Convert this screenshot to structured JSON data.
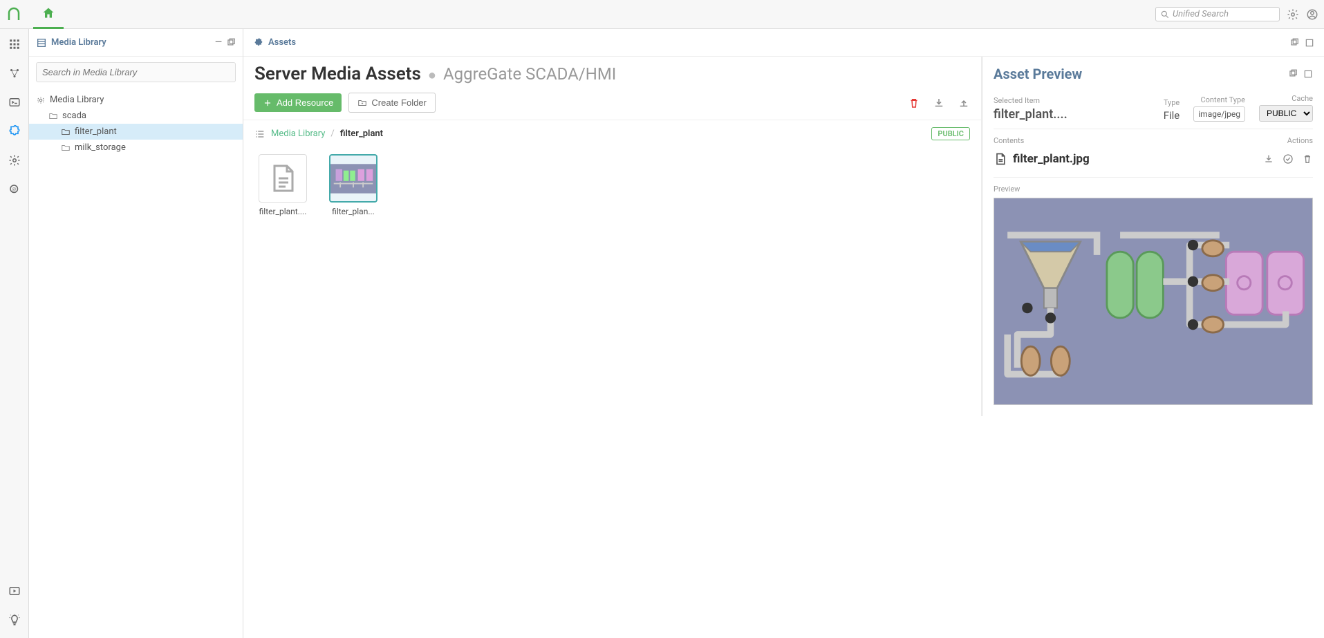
{
  "header": {
    "search_placeholder": "Unified Search"
  },
  "sidebar": {
    "title": "Media Library",
    "search_placeholder": "Search in Media Library",
    "tree": {
      "root": "Media Library",
      "items": [
        {
          "label": "scada"
        },
        {
          "label": "filter_plant"
        },
        {
          "label": "milk_storage"
        }
      ]
    }
  },
  "content": {
    "section": "Assets",
    "title": "Server Media Assets",
    "subtitle": "AggreGate SCADA/HMI",
    "add_resource": "Add Resource",
    "create_folder": "Create Folder",
    "breadcrumb_root": "Media Library",
    "breadcrumb_current": "filter_plant",
    "badge": "PUBLIC",
    "items": [
      {
        "label": "filter_plant...."
      },
      {
        "label": "filter_plan..."
      }
    ]
  },
  "preview": {
    "title": "Asset Preview",
    "selected_item_label": "Selected Item",
    "selected_item_value": "filter_plant....",
    "type_label": "Type",
    "type_value": "File",
    "content_type_label": "Content Type",
    "content_type_value": "image/jpeg",
    "cache_label": "Cache",
    "cache_value": "PUBLIC",
    "contents_label": "Contents",
    "actions_label": "Actions",
    "filename": "filter_plant.jpg",
    "preview_label": "Preview"
  }
}
